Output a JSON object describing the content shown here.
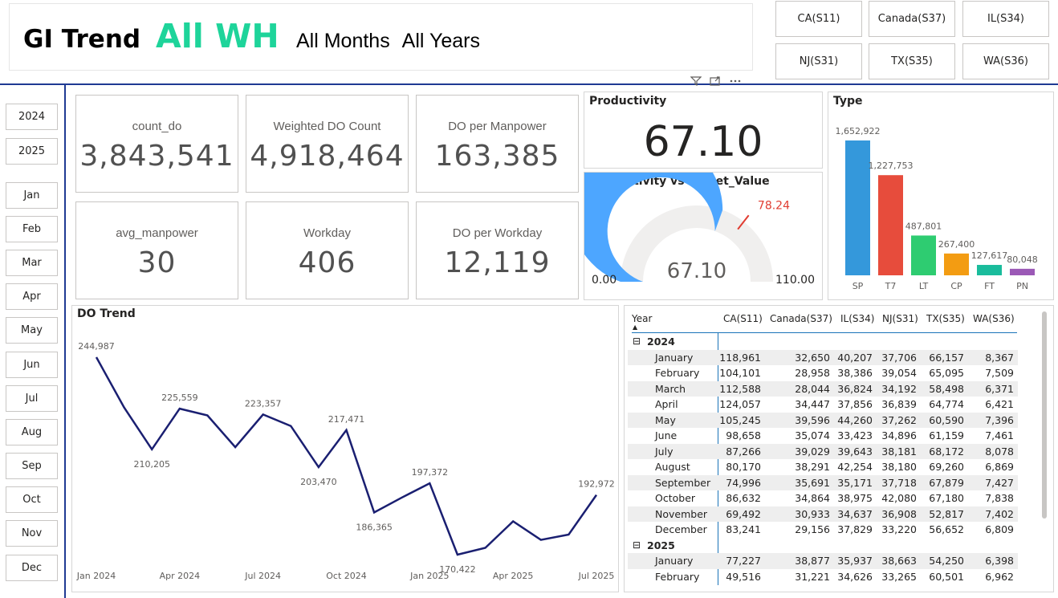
{
  "header": {
    "title": "GI Trend",
    "warehouse": "All WH",
    "months": "All Months",
    "years": "All Years"
  },
  "colors": {
    "accent_green": "#1ed49a",
    "border_blue": "#1f3a93",
    "gauge_fill": "#4da6ff",
    "gauge_target": "#e03c31",
    "line": "#1a1f71"
  },
  "warehouse_buttons": [
    "CA(S11)",
    "Canada(S37)",
    "IL(S34)",
    "NJ(S31)",
    "TX(S35)",
    "WA(S36)"
  ],
  "visual_icons": [
    "filter-icon",
    "focus-mode-icon",
    "more-options-icon"
  ],
  "year_slicer": [
    "2024",
    "2025"
  ],
  "month_slicer": [
    "Jan",
    "Feb",
    "Mar",
    "Apr",
    "May",
    "Jun",
    "Jul",
    "Aug",
    "Sep",
    "Oct",
    "Nov",
    "Dec"
  ],
  "cards": [
    {
      "label": "count_do",
      "value": "3,843,541"
    },
    {
      "label": "Weighted DO Count",
      "value": "4,918,464"
    },
    {
      "label": "DO per Manpower",
      "value": "163,385"
    },
    {
      "label": "avg_manpower",
      "value": "30"
    },
    {
      "label": "Workday",
      "value": "406"
    },
    {
      "label": "DO per Workday",
      "value": "12,119"
    }
  ],
  "productivity": {
    "title": "Productivity",
    "value": "67.10"
  },
  "gauge": {
    "title": "Productivity vs Target_Value",
    "value": 67.1,
    "value_label": "67.10",
    "min": 0,
    "min_label": "0.00",
    "max": 110,
    "max_label": "110.00",
    "target": 78.24,
    "target_label": "78.24"
  },
  "type_chart": {
    "title": "Type",
    "chart_data": {
      "type": "bar",
      "categories": [
        "SP",
        "T7",
        "LT",
        "CP",
        "FT",
        "PN"
      ],
      "values": [
        1652922,
        1227753,
        487801,
        267400,
        127617,
        80048
      ],
      "labels": [
        "1,652,922",
        "1,227,753",
        "487,801",
        "267,400",
        "127,617",
        "80,048"
      ],
      "colors": [
        "#3498db",
        "#e74c3c",
        "#2ecc71",
        "#f39c12",
        "#1abc9c",
        "#9b59b6"
      ],
      "ylim": [
        0,
        1652922
      ]
    }
  },
  "do_trend": {
    "title": "DO Trend",
    "chart_data": {
      "type": "line",
      "x": [
        "Jan 2024",
        "Feb 2024",
        "Mar 2024",
        "Apr 2024",
        "May 2024",
        "Jun 2024",
        "Jul 2024",
        "Aug 2024",
        "Sep 2024",
        "Oct 2024",
        "Nov 2024",
        "Dec 2024",
        "Jan 2025",
        "Feb 2025",
        "Mar 2025",
        "Apr 2025",
        "May 2025",
        "Jun 2025",
        "Jul 2025"
      ],
      "values": [
        244987,
        226000,
        210205,
        225559,
        223000,
        211000,
        223357,
        219000,
        203470,
        217471,
        186365,
        192000,
        197372,
        170422,
        173000,
        183000,
        176000,
        178000,
        192972
      ],
      "data_labels": [
        {
          "index": 0,
          "text": "244,987"
        },
        {
          "index": 2,
          "text": "210,205"
        },
        {
          "index": 3,
          "text": "225,559"
        },
        {
          "index": 6,
          "text": "223,357"
        },
        {
          "index": 8,
          "text": "203,470"
        },
        {
          "index": 9,
          "text": "217,471"
        },
        {
          "index": 10,
          "text": "186,365"
        },
        {
          "index": 12,
          "text": "197,372"
        },
        {
          "index": 13,
          "text": "170,422"
        },
        {
          "index": 18,
          "text": "192,972"
        }
      ],
      "xticks": [
        {
          "index": 0,
          "text": "Jan 2024"
        },
        {
          "index": 3,
          "text": "Apr 2024"
        },
        {
          "index": 6,
          "text": "Jul 2024"
        },
        {
          "index": 9,
          "text": "Oct 2024"
        },
        {
          "index": 12,
          "text": "Jan 2025"
        },
        {
          "index": 15,
          "text": "Apr 2025"
        },
        {
          "index": 18,
          "text": "Jul 2025"
        }
      ],
      "ylim": [
        160000,
        255000
      ]
    }
  },
  "matrix": {
    "columns": [
      "Year",
      "CA(S11)",
      "Canada(S37)",
      "IL(S34)",
      "NJ(S31)",
      "TX(S35)",
      "WA(S36)"
    ],
    "groups": [
      {
        "year": "2024",
        "rows": [
          [
            "January",
            "118,961",
            "32,650",
            "40,207",
            "37,706",
            "66,157",
            "8,367"
          ],
          [
            "February",
            "104,101",
            "28,958",
            "38,386",
            "39,054",
            "65,095",
            "7,509"
          ],
          [
            "March",
            "112,588",
            "28,044",
            "36,824",
            "34,192",
            "58,498",
            "6,371"
          ],
          [
            "April",
            "124,057",
            "34,447",
            "37,856",
            "36,839",
            "64,774",
            "6,421"
          ],
          [
            "May",
            "105,245",
            "39,596",
            "44,260",
            "37,262",
            "60,590",
            "7,396"
          ],
          [
            "June",
            "98,658",
            "35,074",
            "33,423",
            "34,896",
            "61,159",
            "7,461"
          ],
          [
            "July",
            "87,266",
            "39,029",
            "39,643",
            "38,181",
            "68,172",
            "8,078"
          ],
          [
            "August",
            "80,170",
            "38,291",
            "42,254",
            "38,180",
            "69,260",
            "6,869"
          ],
          [
            "September",
            "74,996",
            "35,691",
            "35,171",
            "37,718",
            "67,879",
            "7,427"
          ],
          [
            "October",
            "86,632",
            "34,864",
            "38,975",
            "42,080",
            "67,180",
            "7,838"
          ],
          [
            "November",
            "69,492",
            "30,933",
            "34,637",
            "36,908",
            "52,817",
            "7,402"
          ],
          [
            "December",
            "83,241",
            "29,156",
            "37,829",
            "33,220",
            "56,652",
            "6,809"
          ]
        ]
      },
      {
        "year": "2025",
        "rows": [
          [
            "January",
            "77,227",
            "38,877",
            "35,937",
            "38,663",
            "54,250",
            "6,398"
          ],
          [
            "February",
            "49,516",
            "31,221",
            "34,626",
            "33,265",
            "60,501",
            "6,962"
          ]
        ]
      }
    ]
  }
}
